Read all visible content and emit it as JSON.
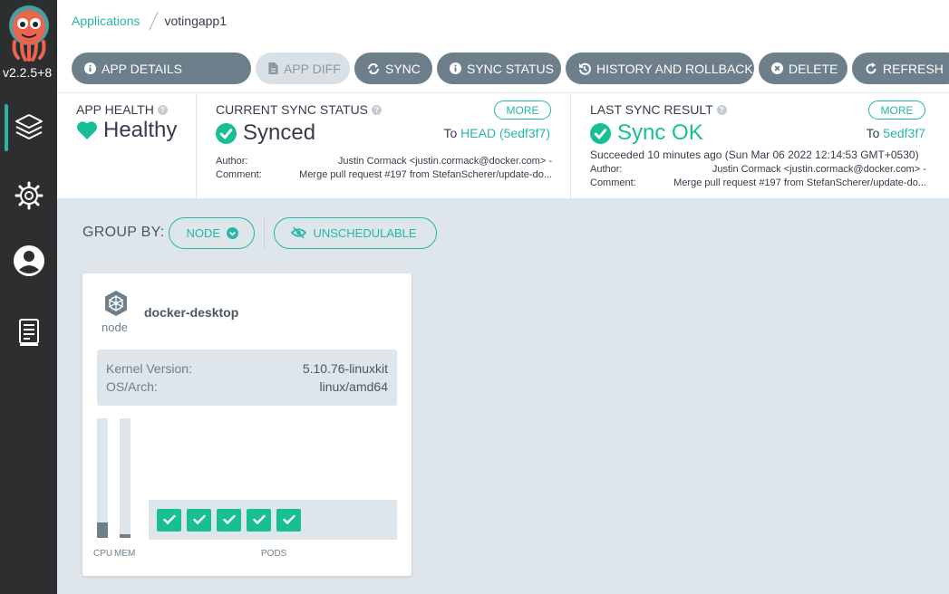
{
  "sidebar": {
    "version": "v2.2.5+8",
    "items": [
      {
        "icon": "applications-stack-icon",
        "active": true
      },
      {
        "icon": "settings-gear-icon",
        "active": false
      },
      {
        "icon": "user-icon",
        "active": false
      },
      {
        "icon": "docs-icon",
        "active": false
      }
    ]
  },
  "breadcrumb": {
    "root": "Applications",
    "current": "votingapp1"
  },
  "toolbar": {
    "app_details": "APP DETAILS",
    "app_diff": "APP DIFF",
    "sync": "SYNC",
    "sync_status": "SYNC STATUS",
    "history": "HISTORY AND ROLLBACK",
    "delete": "DELETE",
    "refresh": "REFRESH"
  },
  "app_health": {
    "title": "APP HEALTH",
    "value": "Healthy"
  },
  "current_sync": {
    "title": "CURRENT SYNC STATUS",
    "value": "Synced",
    "more": "MORE",
    "to_prefix": "To",
    "to_ref": "HEAD (5edf3f7)",
    "author_label": "Author:",
    "author_value": "Justin Cormack <justin.cormack@docker.com> -",
    "comment_label": "Comment:",
    "comment_value": "Merge pull request #197 from StefanScherer/update-do..."
  },
  "last_sync": {
    "title": "LAST SYNC RESULT",
    "value": "Sync OK",
    "more": "MORE",
    "to_prefix": "To",
    "to_ref": "5edf3f7",
    "succeeded": "Succeeded 10 minutes ago (Sun Mar 06 2022 12:14:53 GMT+0530)",
    "author_label": "Author:",
    "author_value": "Justin Cormack <justin.cormack@docker.com> -",
    "comment_label": "Comment:",
    "comment_value": "Merge pull request #197 from StefanScherer/update-do..."
  },
  "group_by": {
    "label": "GROUP BY:",
    "node": "NODE",
    "unschedulable": "UNSCHEDULABLE"
  },
  "node_card": {
    "kind": "node",
    "name": "docker-desktop",
    "kernel_label": "Kernel Version:",
    "kernel_value": "5.10.76-linuxkit",
    "arch_label": "OS/Arch:",
    "arch_value": "linux/amd64",
    "cpu_label": "CPU",
    "mem_label": "MEM",
    "pods_label": "PODS",
    "cpu_fraction": 0.13,
    "mem_fraction": 0.03,
    "pods_count": 5
  },
  "colors": {
    "accent": "#26b6a6",
    "healthy": "#18be94",
    "sidebar": "#2d2e30",
    "button": "#6d7f8b"
  }
}
